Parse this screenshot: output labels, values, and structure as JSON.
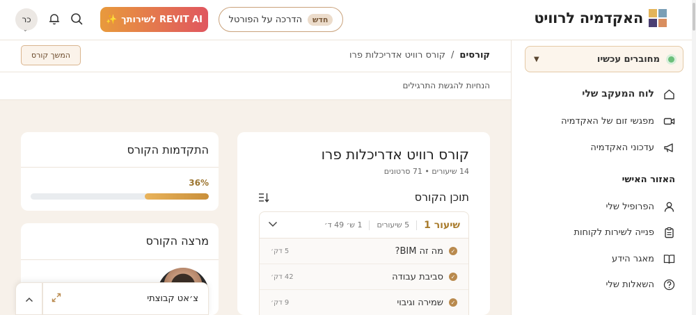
{
  "header": {
    "logo_text": "האקדמיה לרוויט",
    "tour_button": {
      "badge": "חדש",
      "label": "הדרכה על הפורטל"
    },
    "ai_button": {
      "label": "REVIT AI לשירותך",
      "icon": "sparkle-icon"
    },
    "avatar_initials": "כר"
  },
  "sidebar": {
    "status": "מחוברים עכשיו",
    "items": [
      {
        "label": "לוח המעקב שלי",
        "icon": "home-icon"
      },
      {
        "label": "מפגשי זום של האקדמיה",
        "icon": "video-icon"
      },
      {
        "label": "עדכוני האקדמיה",
        "icon": "megaphone-icon"
      }
    ],
    "section_title": "האזור האישי",
    "personal_items": [
      {
        "label": "הפרופיל שלי",
        "icon": "user-icon"
      },
      {
        "label": "פנייה לשירות לקוחות",
        "icon": "clipboard-icon"
      },
      {
        "label": "מאגר הידע",
        "icon": "book-icon"
      },
      {
        "label": "השאלות שלי",
        "icon": "question-icon"
      }
    ]
  },
  "breadcrumb": {
    "root": "קורסים",
    "separator": "/",
    "current": "קורס רוויט אדריכלות פרו"
  },
  "continue_button": "המשך קורס",
  "guidelines_link": "הנחיות להגשת התרגילים",
  "course": {
    "title": "קורס רוויט אדריכלות פרו",
    "meta": "14 שיעורים • 71 סרטונים",
    "content_title": "תוכן הקורס",
    "lesson": {
      "title": "שיעור 1",
      "count": "5 שיעורים",
      "duration": "1 ש׳ 49 ד׳",
      "rows": [
        {
          "name": "מה זה BIM?",
          "duration": "5 דק׳"
        },
        {
          "name": "סביבת עבודה",
          "duration": "42 דק׳"
        },
        {
          "name": "שמירה וגיבוי",
          "duration": "9 דק׳"
        }
      ]
    }
  },
  "progress": {
    "title": "התקדמות הקורס",
    "percent_label": "36%",
    "fraction": 0.36
  },
  "lecturer": {
    "title": "מרצה הקורס"
  },
  "chat": {
    "label": "צ׳אט קבוצתי"
  },
  "colors": {
    "accent": "#b98a4e",
    "ai_gradient_start": "#e89a3c",
    "ai_gradient_end": "#e0565f",
    "online": "#6bbf7a"
  }
}
